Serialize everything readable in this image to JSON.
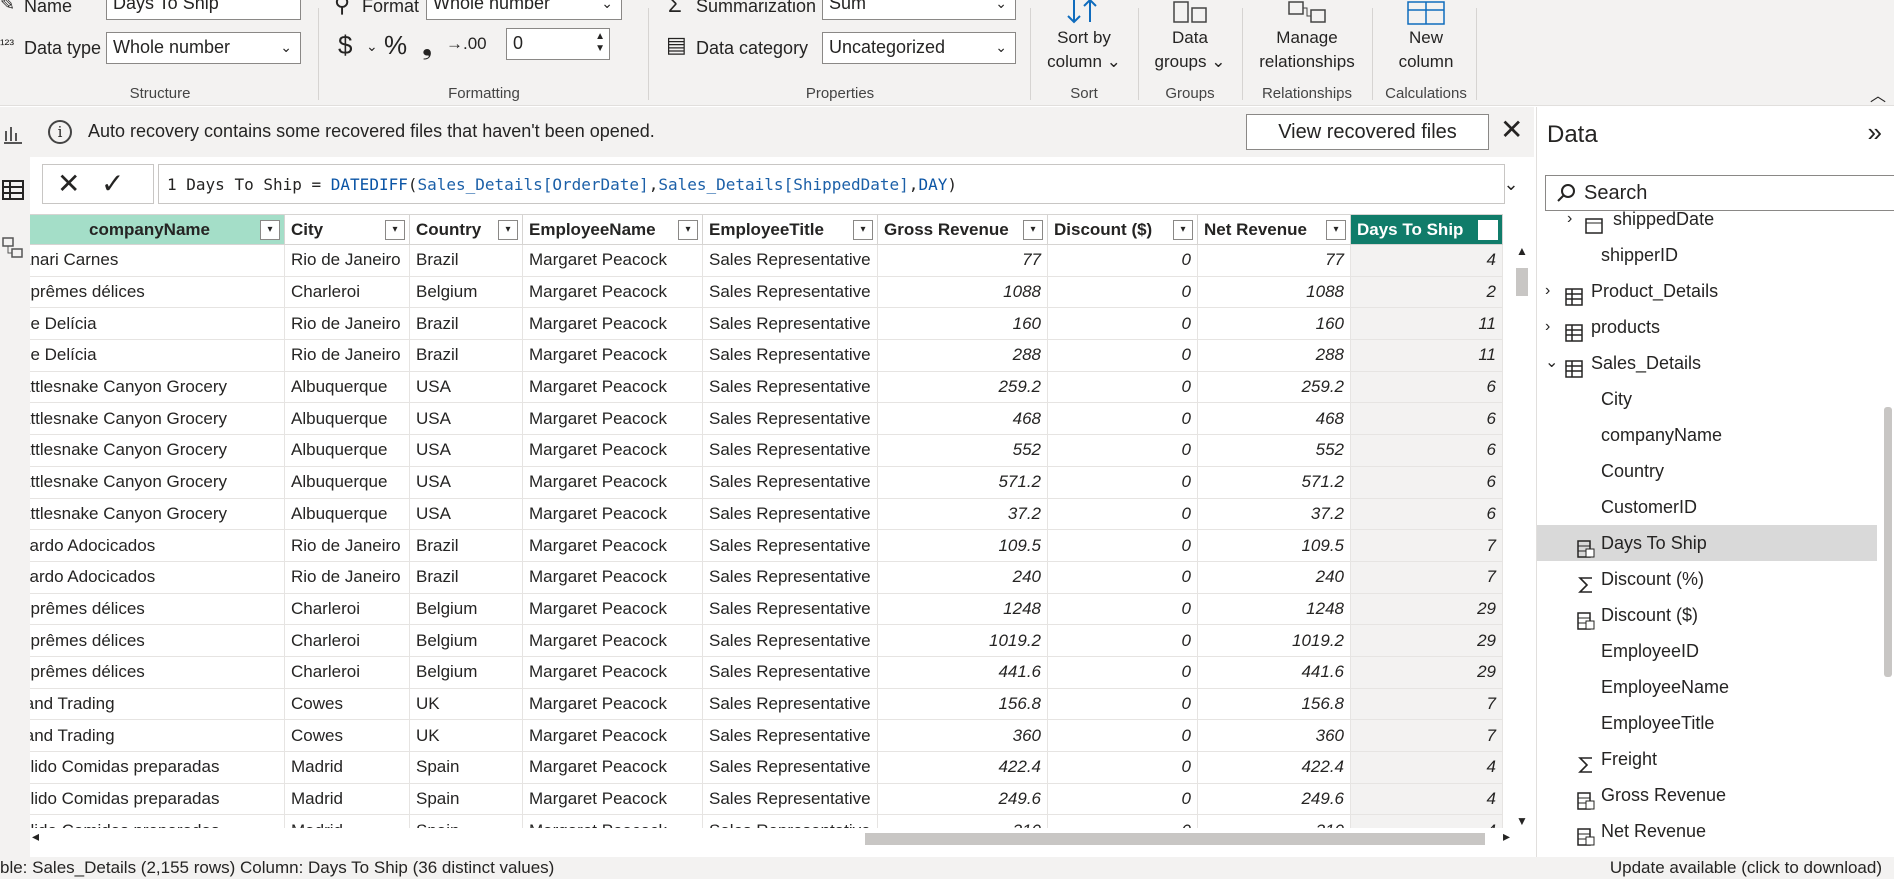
{
  "ribbon": {
    "structure": {
      "name_label": "Name",
      "name_value": "Days To Ship",
      "datatype_label": "Data type",
      "datatype_value": "Whole number",
      "group_label": "Structure"
    },
    "formatting": {
      "format_label": "Format",
      "format_value": "Whole number",
      "currency_symbol": "$",
      "percent_symbol": "%",
      "comma_symbol": "❟",
      "decimals_symbol": "→.00",
      "decimal_places_value": "0",
      "group_label": "Formatting"
    },
    "properties": {
      "summarization_label": "Summarization",
      "summarization_value": "Sum",
      "category_label": "Data category",
      "category_value": "Uncategorized",
      "group_label": "Properties"
    },
    "sort": {
      "button_label_1": "Sort by",
      "button_label_2": "column",
      "group_label": "Sort"
    },
    "groups": {
      "button_label_1": "Data",
      "button_label_2": "groups",
      "group_label": "Groups"
    },
    "relationships": {
      "button_label_1": "Manage",
      "button_label_2": "relationships",
      "group_label": "Relationships"
    },
    "calculations": {
      "button_label_1": "New",
      "button_label_2": "column",
      "group_label": "Calculations"
    }
  },
  "notice": {
    "message": "Auto recovery contains some recovered files that haven't been opened.",
    "button": "View recovered files"
  },
  "formula": {
    "line_no": "1",
    "prefix": "Days To Ship = ",
    "fn": "DATEDIFF",
    "p1": "(",
    "arg1_table": "Sales_Details",
    "arg1_col": "[OrderDate]",
    "comma1": ",",
    "arg2_table": "Sales_Details",
    "arg2_col": "[ShippedDate]",
    "comma2": ",",
    "arg3": "DAY",
    "p2": ")"
  },
  "table": {
    "headers": [
      "companyName",
      "City",
      "Country",
      "EmployeeName",
      "EmployeeTitle",
      "Gross Revenue",
      "Discount ($)",
      "Net Revenue",
      "Days To Ship"
    ],
    "rows": [
      [
        "anari Carnes",
        "Rio de Janeiro",
        "Brazil",
        "Margaret Peacock",
        "Sales Representative",
        "77",
        "0",
        "77",
        "4"
      ],
      [
        "uprêmes délices",
        "Charleroi",
        "Belgium",
        "Margaret Peacock",
        "Sales Representative",
        "1088",
        "0",
        "1088",
        "2"
      ],
      [
        "ue Delícia",
        "Rio de Janeiro",
        "Brazil",
        "Margaret Peacock",
        "Sales Representative",
        "160",
        "0",
        "160",
        "11"
      ],
      [
        "ue Delícia",
        "Rio de Janeiro",
        "Brazil",
        "Margaret Peacock",
        "Sales Representative",
        "288",
        "0",
        "288",
        "11"
      ],
      [
        "attlesnake Canyon Grocery",
        "Albuquerque",
        "USA",
        "Margaret Peacock",
        "Sales Representative",
        "259.2",
        "0",
        "259.2",
        "6"
      ],
      [
        "attlesnake Canyon Grocery",
        "Albuquerque",
        "USA",
        "Margaret Peacock",
        "Sales Representative",
        "468",
        "0",
        "468",
        "6"
      ],
      [
        "attlesnake Canyon Grocery",
        "Albuquerque",
        "USA",
        "Margaret Peacock",
        "Sales Representative",
        "552",
        "0",
        "552",
        "6"
      ],
      [
        "attlesnake Canyon Grocery",
        "Albuquerque",
        "USA",
        "Margaret Peacock",
        "Sales Representative",
        "571.2",
        "0",
        "571.2",
        "6"
      ],
      [
        "attlesnake Canyon Grocery",
        "Albuquerque",
        "USA",
        "Margaret Peacock",
        "Sales Representative",
        "37.2",
        "0",
        "37.2",
        "6"
      ],
      [
        "cardo Adocicados",
        "Rio de Janeiro",
        "Brazil",
        "Margaret Peacock",
        "Sales Representative",
        "109.5",
        "0",
        "109.5",
        "7"
      ],
      [
        "cardo Adocicados",
        "Rio de Janeiro",
        "Brazil",
        "Margaret Peacock",
        "Sales Representative",
        "240",
        "0",
        "240",
        "7"
      ],
      [
        "uprêmes délices",
        "Charleroi",
        "Belgium",
        "Margaret Peacock",
        "Sales Representative",
        "1248",
        "0",
        "1248",
        "29"
      ],
      [
        "uprêmes délices",
        "Charleroi",
        "Belgium",
        "Margaret Peacock",
        "Sales Representative",
        "1019.2",
        "0",
        "1019.2",
        "29"
      ],
      [
        "uprêmes délices",
        "Charleroi",
        "Belgium",
        "Margaret Peacock",
        "Sales Representative",
        "441.6",
        "0",
        "441.6",
        "29"
      ],
      [
        "land Trading",
        "Cowes",
        "UK",
        "Margaret Peacock",
        "Sales Representative",
        "156.8",
        "0",
        "156.8",
        "7"
      ],
      [
        "land Trading",
        "Cowes",
        "UK",
        "Margaret Peacock",
        "Sales Representative",
        "360",
        "0",
        "360",
        "7"
      ],
      [
        "ólido Comidas preparadas",
        "Madrid",
        "Spain",
        "Margaret Peacock",
        "Sales Representative",
        "422.4",
        "0",
        "422.4",
        "4"
      ],
      [
        "ólido Comidas preparadas",
        "Madrid",
        "Spain",
        "Margaret Peacock",
        "Sales Representative",
        "249.6",
        "0",
        "249.6",
        "4"
      ],
      [
        "ólido Comidas preparadas",
        "Madrid",
        "Spain",
        "Margaret Peacock",
        "Sales Representative",
        "310",
        "0",
        "310",
        "4"
      ]
    ]
  },
  "datapane": {
    "title": "Data",
    "search_placeholder": "Search",
    "items": [
      {
        "label": "shippedDate",
        "icon": "calendar-icon",
        "indent": 1,
        "expand": "›"
      },
      {
        "label": "shipperID",
        "icon": "",
        "indent": 2,
        "expand": ""
      },
      {
        "label": "Product_Details",
        "icon": "table-icon",
        "indent": 0,
        "expand": "›"
      },
      {
        "label": "products",
        "icon": "table-icon",
        "indent": 0,
        "expand": "›"
      },
      {
        "label": "Sales_Details",
        "icon": "table-icon",
        "indent": 0,
        "expand": "⌄"
      },
      {
        "label": "City",
        "icon": "",
        "indent": 2,
        "expand": ""
      },
      {
        "label": "companyName",
        "icon": "",
        "indent": 2,
        "expand": ""
      },
      {
        "label": "Country",
        "icon": "",
        "indent": 2,
        "expand": ""
      },
      {
        "label": "CustomerID",
        "icon": "",
        "indent": 2,
        "expand": ""
      },
      {
        "label": "Days To Ship",
        "icon": "calculated-column-icon",
        "indent": 2,
        "expand": "",
        "selected": true
      },
      {
        "label": "Discount (%)",
        "icon": "sigma-icon",
        "indent": 2,
        "expand": ""
      },
      {
        "label": "Discount ($)",
        "icon": "calculated-column-icon",
        "indent": 2,
        "expand": ""
      },
      {
        "label": "EmployeeID",
        "icon": "",
        "indent": 2,
        "expand": ""
      },
      {
        "label": "EmployeeName",
        "icon": "",
        "indent": 2,
        "expand": ""
      },
      {
        "label": "EmployeeTitle",
        "icon": "",
        "indent": 2,
        "expand": ""
      },
      {
        "label": "Freight",
        "icon": "sigma-icon",
        "indent": 2,
        "expand": ""
      },
      {
        "label": "Gross Revenue",
        "icon": "calculated-column-icon",
        "indent": 2,
        "expand": ""
      },
      {
        "label": "Net Revenue",
        "icon": "calculated-column-icon",
        "indent": 2,
        "expand": ""
      }
    ]
  },
  "status": {
    "left": "ble: Sales_Details (2,155 rows) Column: Days To Ship (36 distinct values)",
    "right": "Update available (click to download)"
  },
  "colors": {
    "accent": "#107c6a",
    "header_highlight": "#a4dec8",
    "ribbon_bg": "#f3f2f1"
  }
}
